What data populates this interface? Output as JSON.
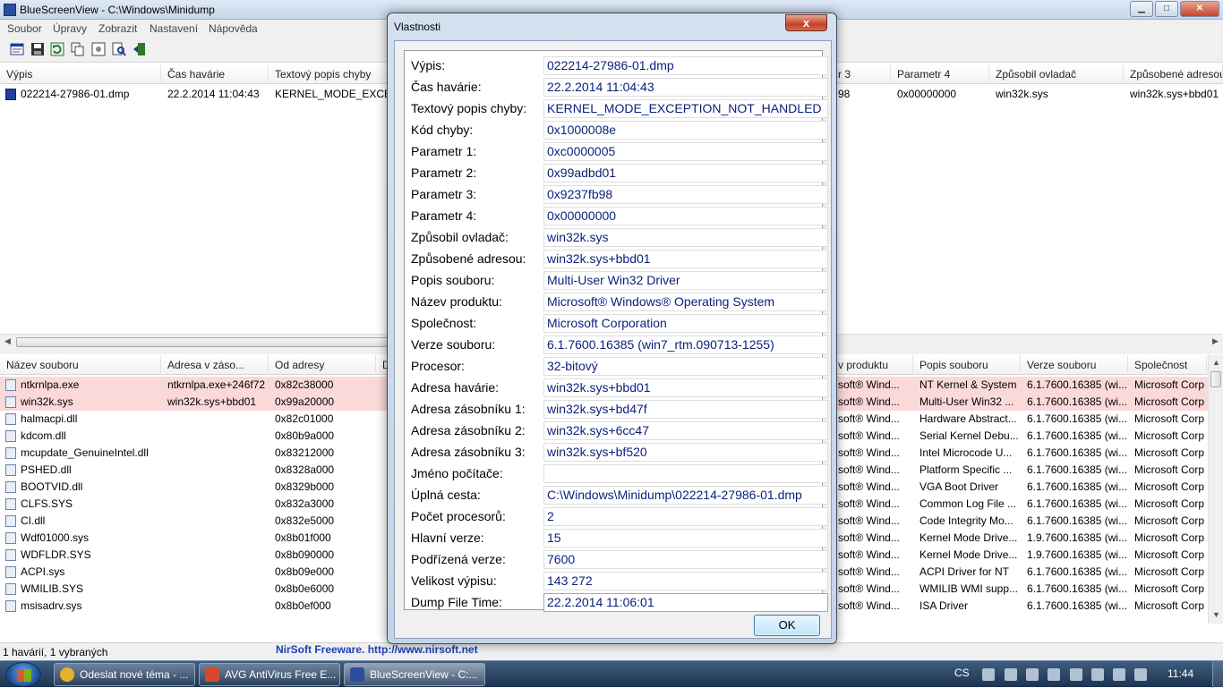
{
  "window": {
    "title": "BlueScreenView  -  C:\\Windows\\Minidump",
    "min_label": "▁",
    "max_label": "□",
    "close_label": "✕"
  },
  "menu": [
    "Soubor",
    "Úpravy",
    "Zobrazit",
    "Nastavení",
    "Nápověda"
  ],
  "toolbar_icons": [
    "properties-icon",
    "save-icon",
    "refresh-icon",
    "copy-icon",
    "advanced-options-icon",
    "find-icon",
    "exit-icon"
  ],
  "top_table": {
    "columns": [
      "Výpis",
      "Čas havárie",
      "Textový popis chyby",
      "r 3",
      "Parametr 4",
      "Způsobil ovladač",
      "Způsobené adresou"
    ],
    "row": [
      "022214-27986-01.dmp",
      "22.2.2014 11:04:43",
      "KERNEL_MODE_EXCEPT",
      "98",
      "0x00000000",
      "win32k.sys",
      "win32k.sys+bbd01"
    ]
  },
  "bottom_table": {
    "columns": [
      "Název souboru",
      "Adresa v záso...",
      "Od adresy",
      "D",
      "v produktu",
      "Popis souboru",
      "Verze souboru",
      "Společnost"
    ],
    "rows": [
      {
        "name": "ntkrnlpa.exe",
        "addr": "ntkrnlpa.exe+246f72",
        "from": "0x82c38000",
        "prod": "soft® Wind...",
        "desc": "NT Kernel & System",
        "ver": "6.1.7600.16385 (wi...",
        "company": "Microsoft Corp",
        "red": true
      },
      {
        "name": "win32k.sys",
        "addr": "win32k.sys+bbd01",
        "from": "0x99a20000",
        "prod": "soft® Wind...",
        "desc": "Multi-User Win32 ...",
        "ver": "6.1.7600.16385 (wi...",
        "company": "Microsoft Corp",
        "red": true
      },
      {
        "name": "halmacpi.dll",
        "addr": "",
        "from": "0x82c01000",
        "prod": "soft® Wind...",
        "desc": "Hardware Abstract...",
        "ver": "6.1.7600.16385 (wi...",
        "company": "Microsoft Corp",
        "red": false
      },
      {
        "name": "kdcom.dll",
        "addr": "",
        "from": "0x80b9a000",
        "prod": "soft® Wind...",
        "desc": "Serial Kernel Debu...",
        "ver": "6.1.7600.16385 (wi...",
        "company": "Microsoft Corp",
        "red": false
      },
      {
        "name": "mcupdate_GenuineIntel.dll",
        "addr": "",
        "from": "0x83212000",
        "prod": "soft® Wind...",
        "desc": "Intel Microcode U...",
        "ver": "6.1.7600.16385 (wi...",
        "company": "Microsoft Corp",
        "red": false
      },
      {
        "name": "PSHED.dll",
        "addr": "",
        "from": "0x8328a000",
        "prod": "soft® Wind...",
        "desc": "Platform Specific ...",
        "ver": "6.1.7600.16385 (wi...",
        "company": "Microsoft Corp",
        "red": false
      },
      {
        "name": "BOOTVID.dll",
        "addr": "",
        "from": "0x8329b000",
        "prod": "soft® Wind...",
        "desc": "VGA Boot Driver",
        "ver": "6.1.7600.16385 (wi...",
        "company": "Microsoft Corp",
        "red": false
      },
      {
        "name": "CLFS.SYS",
        "addr": "",
        "from": "0x832a3000",
        "prod": "soft® Wind...",
        "desc": "Common Log File ...",
        "ver": "6.1.7600.16385 (wi...",
        "company": "Microsoft Corp",
        "red": false
      },
      {
        "name": "CI.dll",
        "addr": "",
        "from": "0x832e5000",
        "prod": "soft® Wind...",
        "desc": "Code Integrity Mo...",
        "ver": "6.1.7600.16385 (wi...",
        "company": "Microsoft Corp",
        "red": false
      },
      {
        "name": "Wdf01000.sys",
        "addr": "",
        "from": "0x8b01f000",
        "prod": "soft® Wind...",
        "desc": "Kernel Mode Drive...",
        "ver": "1.9.7600.16385 (wi...",
        "company": "Microsoft Corp",
        "red": false
      },
      {
        "name": "WDFLDR.SYS",
        "addr": "",
        "from": "0x8b090000",
        "prod": "soft® Wind...",
        "desc": "Kernel Mode Drive...",
        "ver": "1.9.7600.16385 (wi...",
        "company": "Microsoft Corp",
        "red": false
      },
      {
        "name": "ACPI.sys",
        "addr": "",
        "from": "0x8b09e000",
        "prod": "soft® Wind...",
        "desc": "ACPI Driver for NT",
        "ver": "6.1.7600.16385 (wi...",
        "company": "Microsoft Corp",
        "red": false
      },
      {
        "name": "WMILIB.SYS",
        "addr": "",
        "from": "0x8b0e6000",
        "prod": "soft® Wind...",
        "desc": "WMILIB WMI supp...",
        "ver": "6.1.7600.16385 (wi...",
        "company": "Microsoft Corp",
        "red": false
      },
      {
        "name": "msisadrv.sys",
        "addr": "",
        "from": "0x8b0ef000",
        "prod": "soft® Wind...",
        "desc": "ISA Driver",
        "ver": "6.1.7600.16385 (wi...",
        "company": "Microsoft Corp",
        "red": false
      }
    ]
  },
  "statusbar": {
    "summary": "1 havárií, 1 vybraných",
    "link": "NirSoft Freeware.  http://www.nirsoft.net"
  },
  "dialog": {
    "title": "Vlastnosti",
    "close_label": "x",
    "ok_label": "OK",
    "fields": [
      {
        "label": "Výpis:",
        "value": "022214-27986-01.dmp"
      },
      {
        "label": "Čas havárie:",
        "value": "22.2.2014 11:04:43"
      },
      {
        "label": "Textový popis chyby:",
        "value": "KERNEL_MODE_EXCEPTION_NOT_HANDLED"
      },
      {
        "label": "Kód chyby:",
        "value": "0x1000008e"
      },
      {
        "label": "Parametr 1:",
        "value": "0xc0000005"
      },
      {
        "label": "Parametr 2:",
        "value": "0x99adbd01"
      },
      {
        "label": "Parametr 3:",
        "value": "0x9237fb98"
      },
      {
        "label": "Parametr 4:",
        "value": "0x00000000"
      },
      {
        "label": "Způsobil ovladač:",
        "value": "win32k.sys"
      },
      {
        "label": "Způsobené adresou:",
        "value": "win32k.sys+bbd01"
      },
      {
        "label": "Popis souboru:",
        "value": "Multi-User Win32 Driver"
      },
      {
        "label": "Název produktu:",
        "value": "Microsoft® Windows® Operating System"
      },
      {
        "label": "Společnost:",
        "value": "Microsoft Corporation"
      },
      {
        "label": "Verze souboru:",
        "value": "6.1.7600.16385 (win7_rtm.090713-1255)"
      },
      {
        "label": "Procesor:",
        "value": "32-bitový"
      },
      {
        "label": "Adresa havárie:",
        "value": "win32k.sys+bbd01"
      },
      {
        "label": "Adresa zásobníku 1:",
        "value": "win32k.sys+bd47f"
      },
      {
        "label": "Adresa zásobníku 2:",
        "value": "win32k.sys+6cc47"
      },
      {
        "label": "Adresa zásobníku 3:",
        "value": "win32k.sys+bf520"
      },
      {
        "label": "Jméno počítače:",
        "value": ""
      },
      {
        "label": "Úplná cesta:",
        "value": "C:\\Windows\\Minidump\\022214-27986-01.dmp"
      },
      {
        "label": "Počet procesorů:",
        "value": "2"
      },
      {
        "label": "Hlavní verze:",
        "value": "15"
      },
      {
        "label": "Podřízená verze:",
        "value": "7600"
      },
      {
        "label": "Velikost výpisu:",
        "value": "143 272"
      },
      {
        "label": "Dump File Time:",
        "value": "22.2.2014 11:06:01"
      }
    ]
  },
  "taskbar": {
    "items": [
      {
        "label": "Odeslat nové téma - ...",
        "icon": "chrome-icon",
        "color": "#e6b12b"
      },
      {
        "label": "AVG AntiVirus Free E...",
        "icon": "avg-icon",
        "color": "#d9472b"
      },
      {
        "label": "BlueScreenView  -  C:...",
        "icon": "bluescreenview-icon",
        "color": "#2a4d9c"
      }
    ],
    "language": "CS",
    "clock": "11:44"
  },
  "colors": {
    "red_row": "#fbd9d9",
    "value_text": "#0a1f7a",
    "link": "#1f3fb5"
  }
}
